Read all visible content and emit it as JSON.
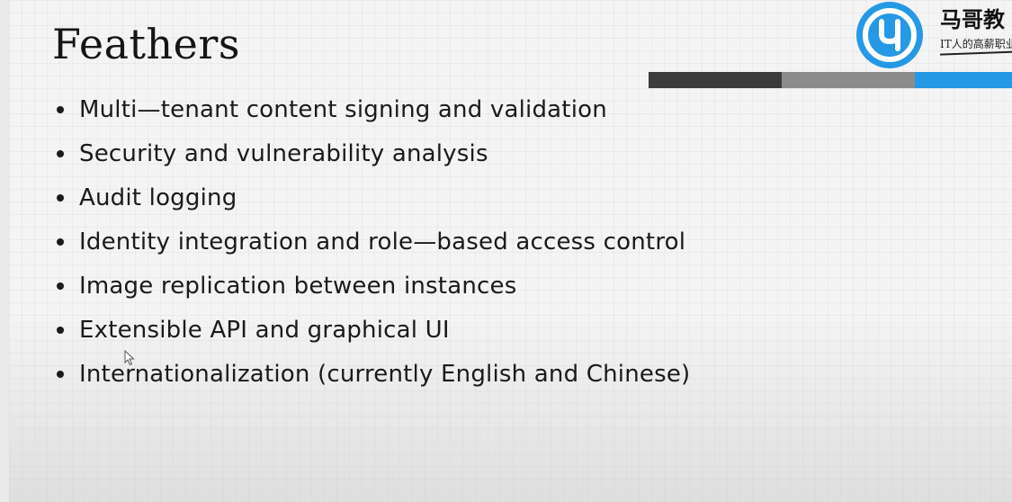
{
  "slide": {
    "title": "Feathers",
    "bullets": [
      "Multi—tenant content signing and validation",
      "Security and vulnerability analysis",
      "Audit logging",
      "Identity integration and role—based access control",
      "Image replication between instances",
      "Extensible API and graphical UI",
      "Internationalization (currently English and Chinese)"
    ]
  },
  "logo": {
    "name": "马哥教",
    "tagline": "IT人的高薪职业",
    "icon": "magedu-logo-icon"
  },
  "colors": {
    "accent_blue": "#2598e6",
    "bar_dark": "#3b3b3b",
    "bar_grey": "#8c8c8c",
    "text": "#1a1a1a"
  },
  "cursor_icon": "mouse-pointer-icon"
}
